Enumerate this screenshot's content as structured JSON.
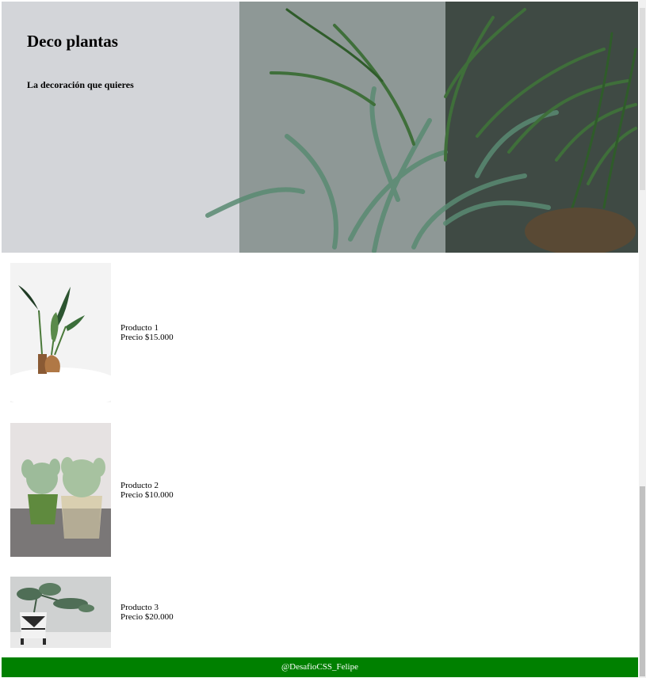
{
  "hero": {
    "title": "Deco plantas",
    "subtitle": "La decoración que quieres"
  },
  "products": [
    {
      "name": "Producto 1",
      "price": "Precio $15.000"
    },
    {
      "name": "Producto 2",
      "price": "Precio $10.000"
    },
    {
      "name": "Producto 3",
      "price": "Precio $20.000"
    }
  ],
  "footer": {
    "text": "@DesafioCSS_Felipe"
  },
  "colors": {
    "footer_bg": "#008000",
    "plant_green": "#4f7a68"
  }
}
